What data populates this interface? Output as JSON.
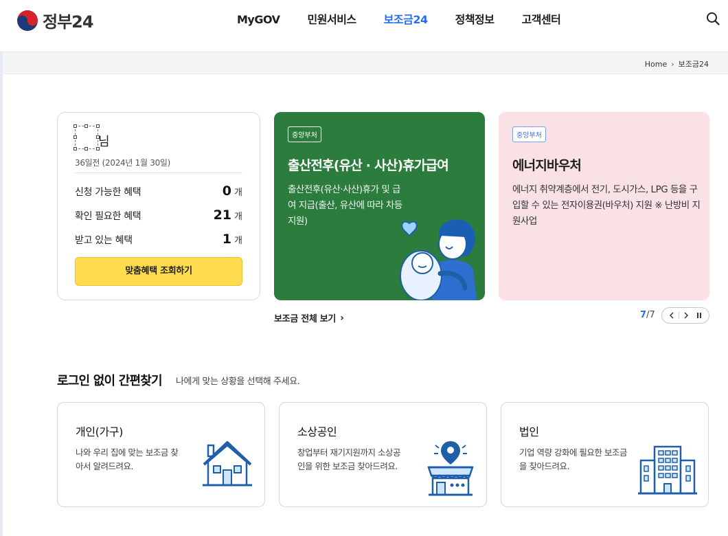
{
  "header": {
    "logo_text": "정부24",
    "nav": [
      {
        "label": "MyGOV",
        "active": false
      },
      {
        "label": "민원서비스",
        "active": false
      },
      {
        "label": "보조금24",
        "active": true
      },
      {
        "label": "정책정보",
        "active": false
      },
      {
        "label": "고객센터",
        "active": false
      }
    ],
    "search_icon": "search-icon"
  },
  "breadcrumb": {
    "home": "Home",
    "current": "보조금24"
  },
  "user_card": {
    "name_suffix": "님",
    "date": "36일전 (2024년 1월 30일)",
    "stats": [
      {
        "label": "신청 가능한 혜택",
        "value": "0",
        "unit": "개"
      },
      {
        "label": "확인 필요한 혜택",
        "value": "21",
        "unit": "개"
      },
      {
        "label": "받고 있는 혜택",
        "value": "1",
        "unit": "개"
      }
    ],
    "cta": "맞춤혜택 조회하기"
  },
  "slides": [
    {
      "badge": "중앙부처",
      "title": "출산전후(유산 · 사산)휴가급여",
      "desc": "출산전후(유산·사산)휴가 및 급여 지급(출산, 유산에 따라 차등지원)",
      "bg": "#2c7d3d"
    },
    {
      "badge": "중앙부처",
      "title": "에너지바우처",
      "desc": "에너지 취약계층에서 전기, 도시가스, LPG 등을 구입할 수 있는 전자이용권(바우처) 지원 ※ 난방비 지원사업",
      "bg": "#f9e1e6"
    }
  ],
  "all_link": "보조금 전체 보기",
  "pager": {
    "current": "7",
    "sep": "/",
    "total": "7"
  },
  "quick_find": {
    "title": "로그인 없이 간편찾기",
    "subtitle": "나에게 맞는 상황을 선택해 주세요.",
    "cards": [
      {
        "title": "개인(가구)",
        "desc": "나와 우리 집에 맞는 보조금 찾아서 알려드려요.",
        "icon": "house-icon"
      },
      {
        "title": "소상공인",
        "desc": "창업부터 재기지원까지 소상공인을 위한 보조금 찾아드려요.",
        "icon": "store-icon"
      },
      {
        "title": "법인",
        "desc": "기업 역량 강화에 필요한 보조금을 찾아드려요.",
        "icon": "building-icon"
      }
    ]
  },
  "colors": {
    "accent": "#256ef4",
    "cta": "#ffdc4d",
    "icon_blue": "#1f5fa8"
  }
}
